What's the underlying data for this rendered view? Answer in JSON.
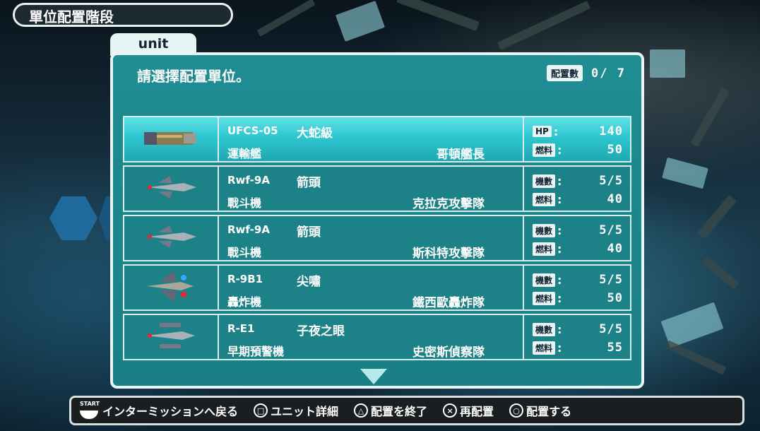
{
  "header": {
    "title": "單位配置階段",
    "tab": "unit"
  },
  "panel": {
    "prompt": "請選擇配置單位。",
    "count_label": "配置數",
    "count_value": "0/ 7"
  },
  "units": [
    {
      "code": "UFCS-05",
      "name": "大蛇級",
      "type": "運輸艦",
      "squad": "哥頓艦長",
      "stat1_label": "HP",
      "stat1_value": "140",
      "stat2_label": "燃料",
      "stat2_value": "50",
      "selected": true,
      "icon": "transport-ship-icon"
    },
    {
      "code": "Rwf-9A",
      "name": "箭頭",
      "type": "戰斗機",
      "squad": "克拉克攻擊隊",
      "stat1_label": "機數",
      "stat1_value": "5/5",
      "stat2_label": "燃料",
      "stat2_value": "40",
      "selected": false,
      "icon": "fighter-ship-icon"
    },
    {
      "code": "Rwf-9A",
      "name": "箭頭",
      "type": "戰斗機",
      "squad": "斯科特攻擊隊",
      "stat1_label": "機數",
      "stat1_value": "5/5",
      "stat2_label": "燃料",
      "stat2_value": "40",
      "selected": false,
      "icon": "fighter-ship-icon"
    },
    {
      "code": "R-9B1",
      "name": "尖嘯",
      "type": "轟炸機",
      "squad": "鐵西歐轟炸隊",
      "stat1_label": "機數",
      "stat1_value": "5/5",
      "stat2_label": "燃料",
      "stat2_value": "50",
      "selected": false,
      "icon": "bomber-ship-icon"
    },
    {
      "code": "R-E1",
      "name": "子夜之眼",
      "type": "早期預警機",
      "squad": "史密斯偵察隊",
      "stat1_label": "機數",
      "stat1_value": "5/5",
      "stat2_label": "燃料",
      "stat2_value": "55",
      "selected": false,
      "icon": "recon-ship-icon"
    }
  ],
  "controls": {
    "start_label": "START",
    "start_text": "インターミッションへ戻る",
    "square_text": "ユニット詳細",
    "triangle_text": "配置を終了",
    "cross_text": "再配置",
    "circle_text": "配置する"
  },
  "colors": {
    "panel": "#1f8d93",
    "selected_row": "#3fd2da",
    "frame": "#e9f4f4"
  }
}
